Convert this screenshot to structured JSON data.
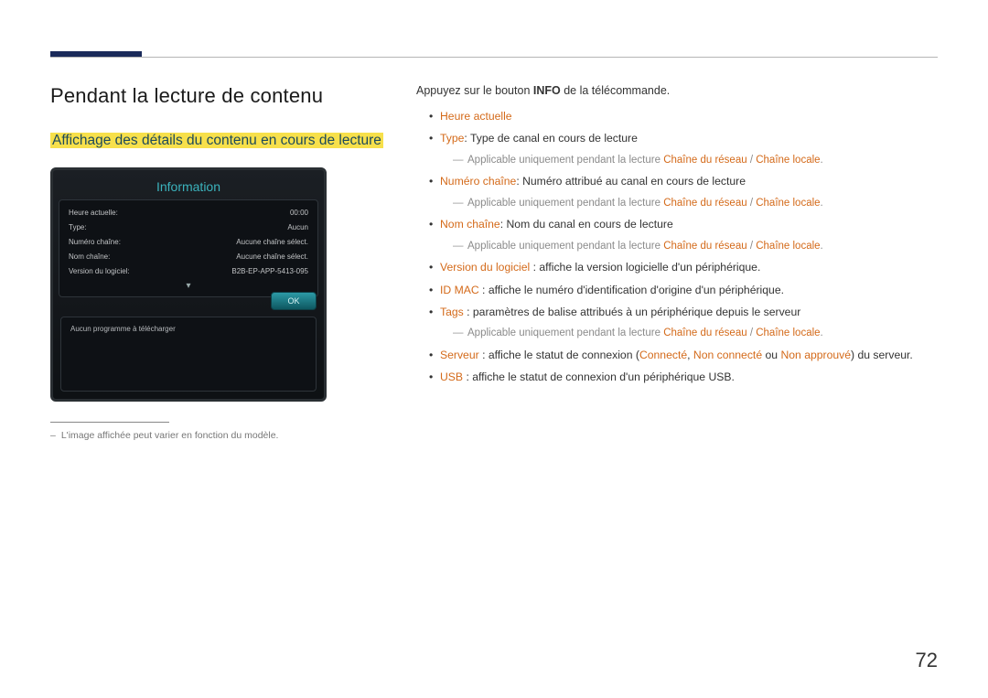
{
  "page_number": "72",
  "heading": "Pendant la lecture de contenu",
  "subheading": "Affichage des détails du contenu en cours de lecture",
  "device": {
    "title": "Information",
    "rows": [
      {
        "label": "Heure actuelle:",
        "value": "00:00"
      },
      {
        "label": "Type:",
        "value": "Aucun"
      },
      {
        "label": "Numéro chaîne:",
        "value": "Aucune chaîne sélect."
      },
      {
        "label": "Nom chaîne:",
        "value": "Aucune chaîne sélect."
      },
      {
        "label": "Version du logiciel:",
        "value": "B2B-EP-APP-5413-095"
      }
    ],
    "ok_label": "OK",
    "download_msg": "Aucun programme à télécharger"
  },
  "footnote": "L'image affichée peut varier en fonction du modèle.",
  "intro": {
    "pre": "Appuyez sur le bouton ",
    "bold": "INFO",
    "post": " de la télécommande."
  },
  "items": {
    "heure": "Heure actuelle",
    "type_label": "Type",
    "type_text": ": Type de canal en cours de lecture",
    "numero_label": "Numéro chaîne",
    "numero_text": ": Numéro attribué au canal en cours de lecture",
    "nom_label": "Nom chaîne",
    "nom_text": ": Nom du canal en cours de lecture",
    "version_label": "Version du logiciel",
    "version_text": " : affiche la version logicielle d'un périphérique.",
    "idmac_label": "ID MAC",
    "idmac_text": " : affiche le numéro d'identification d'origine d'un périphérique.",
    "tags_label": "Tags",
    "tags_text": " : paramètres de balise attribués à un périphérique depuis le serveur",
    "serveur_label": "Serveur",
    "serveur_text1": " : affiche le statut de connexion (",
    "serveur_c1": "Connecté",
    "serveur_sep": ", ",
    "serveur_c2": "Non connecté",
    "serveur_or": " ou ",
    "serveur_c3": "Non approuvé",
    "serveur_text2": ") du serveur.",
    "usb_label": "USB",
    "usb_text": " : affiche le statut de connexion d'un périphérique USB."
  },
  "note": {
    "pre": "Applicable uniquement pendant la lecture ",
    "t1": "Chaîne du réseau",
    "sep": " / ",
    "t2": "Chaîne locale",
    "end": "."
  }
}
